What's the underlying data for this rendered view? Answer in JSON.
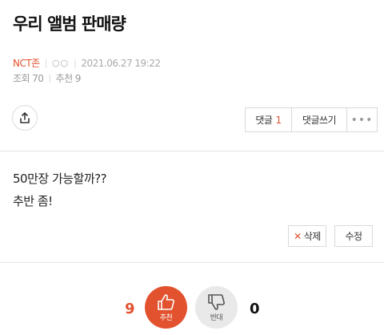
{
  "post": {
    "title": "우리 앨범 판매량",
    "author": "NCT존",
    "author_extra": "○○",
    "date": "2021.06.27 19:22",
    "views_label": "조회",
    "views": "70",
    "recommend_label": "추천",
    "recommend": "9",
    "body_lines": [
      "50만장 가능할까??",
      "추반 좀!"
    ]
  },
  "actions": {
    "comments_label": "댓글",
    "comments_count": "1",
    "write_comment_label": "댓글쓰기",
    "more_label": "•••",
    "delete_label": "삭제",
    "edit_label": "수정"
  },
  "votes": {
    "up_count": "9",
    "up_label": "추천",
    "down_count": "0",
    "down_label": "반대",
    "accent_color": "#e2522e"
  },
  "icons": {
    "share": "share-icon",
    "more": "more-dots-icon",
    "delete": "close-x-icon",
    "thumb_up": "thumbs-up-icon",
    "thumb_down": "thumbs-down-icon"
  }
}
